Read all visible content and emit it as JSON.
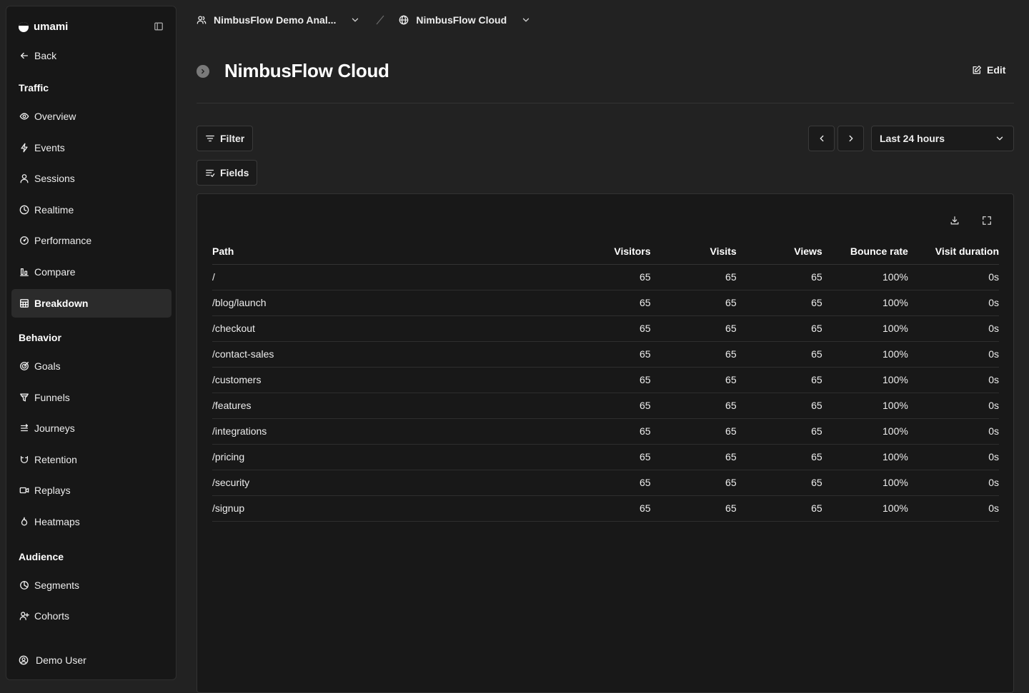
{
  "app": {
    "brand": "umami",
    "back_label": "Back"
  },
  "sidebar": {
    "sections": [
      {
        "title": "Traffic",
        "items": [
          {
            "label": "Overview",
            "icon": "eye-icon"
          },
          {
            "label": "Events",
            "icon": "lightning-icon"
          },
          {
            "label": "Sessions",
            "icon": "user-icon"
          },
          {
            "label": "Realtime",
            "icon": "clock-icon"
          },
          {
            "label": "Performance",
            "icon": "gauge-icon"
          },
          {
            "label": "Compare",
            "icon": "compare-icon"
          },
          {
            "label": "Breakdown",
            "icon": "grid-icon",
            "active": true
          }
        ]
      },
      {
        "title": "Behavior",
        "items": [
          {
            "label": "Goals",
            "icon": "target-icon"
          },
          {
            "label": "Funnels",
            "icon": "funnel-icon"
          },
          {
            "label": "Journeys",
            "icon": "route-icon"
          },
          {
            "label": "Retention",
            "icon": "magnet-icon"
          },
          {
            "label": "Replays",
            "icon": "video-icon"
          },
          {
            "label": "Heatmaps",
            "icon": "flame-icon"
          }
        ]
      },
      {
        "title": "Audience",
        "items": [
          {
            "label": "Segments",
            "icon": "pie-icon"
          },
          {
            "label": "Cohorts",
            "icon": "user-plus-icon"
          }
        ]
      }
    ],
    "user_label": "Demo User"
  },
  "header": {
    "team_label": "NimbusFlow Demo Anal...",
    "website_label": "NimbusFlow Cloud",
    "page_title": "NimbusFlow Cloud",
    "edit_label": "Edit"
  },
  "toolbar": {
    "filter_label": "Filter",
    "fields_label": "Fields",
    "range_label": "Last 24 hours"
  },
  "table": {
    "columns": [
      "Path",
      "Visitors",
      "Visits",
      "Views",
      "Bounce rate",
      "Visit duration"
    ],
    "rows": [
      [
        "/",
        "65",
        "65",
        "65",
        "100%",
        "0s"
      ],
      [
        "/blog/launch",
        "65",
        "65",
        "65",
        "100%",
        "0s"
      ],
      [
        "/checkout",
        "65",
        "65",
        "65",
        "100%",
        "0s"
      ],
      [
        "/contact-sales",
        "65",
        "65",
        "65",
        "100%",
        "0s"
      ],
      [
        "/customers",
        "65",
        "65",
        "65",
        "100%",
        "0s"
      ],
      [
        "/features",
        "65",
        "65",
        "65",
        "100%",
        "0s"
      ],
      [
        "/integrations",
        "65",
        "65",
        "65",
        "100%",
        "0s"
      ],
      [
        "/pricing",
        "65",
        "65",
        "65",
        "100%",
        "0s"
      ],
      [
        "/security",
        "65",
        "65",
        "65",
        "100%",
        "0s"
      ],
      [
        "/signup",
        "65",
        "65",
        "65",
        "100%",
        "0s"
      ]
    ]
  },
  "colors": {
    "background": "#222222",
    "sidebar": "#171717",
    "panel": "#181818",
    "text": "#ededed",
    "active_item": "#2b2b2b"
  }
}
